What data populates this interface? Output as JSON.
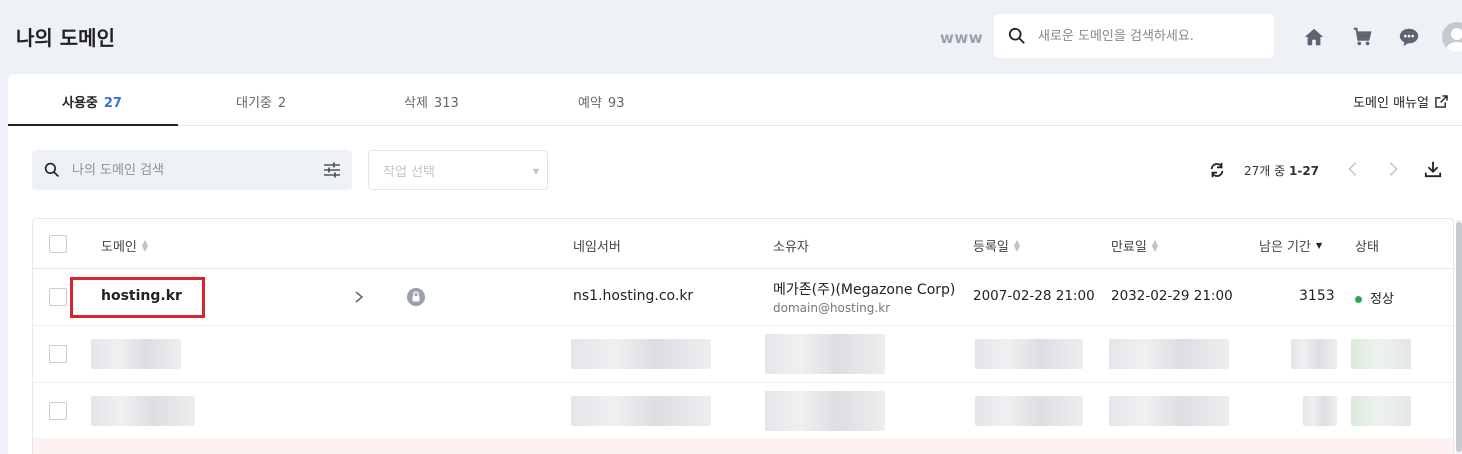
{
  "header": {
    "title": "나의 도메인",
    "www_label": "www",
    "search_placeholder": "새로운 도메인을 검색하세요."
  },
  "tabs": [
    {
      "label": "사용중",
      "count": "27",
      "active": true
    },
    {
      "label": "대기중",
      "count": "2",
      "active": false
    },
    {
      "label": "삭제",
      "count": "313",
      "active": false
    },
    {
      "label": "예약",
      "count": "93",
      "active": false
    }
  ],
  "manual_link": "도메인 매뉴얼",
  "toolbar": {
    "search_placeholder": "나의 도메인 검색",
    "task_select": "작업 선택",
    "pager_prefix": "27개 중 ",
    "pager_range": "1-27"
  },
  "table": {
    "columns": {
      "domain": "도메인",
      "nameserver": "네임서버",
      "owner": "소유자",
      "registered": "등록일",
      "expires": "만료일",
      "remaining": "남은 기간",
      "status": "상태"
    },
    "rows": [
      {
        "domain": "hosting.kr",
        "nameserver": "ns1.hosting.co.kr",
        "owner_name": "메가존(주)(Megazone Corp)",
        "owner_email": "domain@hosting.kr",
        "registered": "2007-02-28 21:00",
        "expires": "2032-02-29 21:00",
        "remaining": "3153",
        "status": "정상"
      }
    ]
  },
  "colors": {
    "accent": "#3b6fd8",
    "highlight": "#d9232d",
    "status_ok": "#2aa84a"
  }
}
